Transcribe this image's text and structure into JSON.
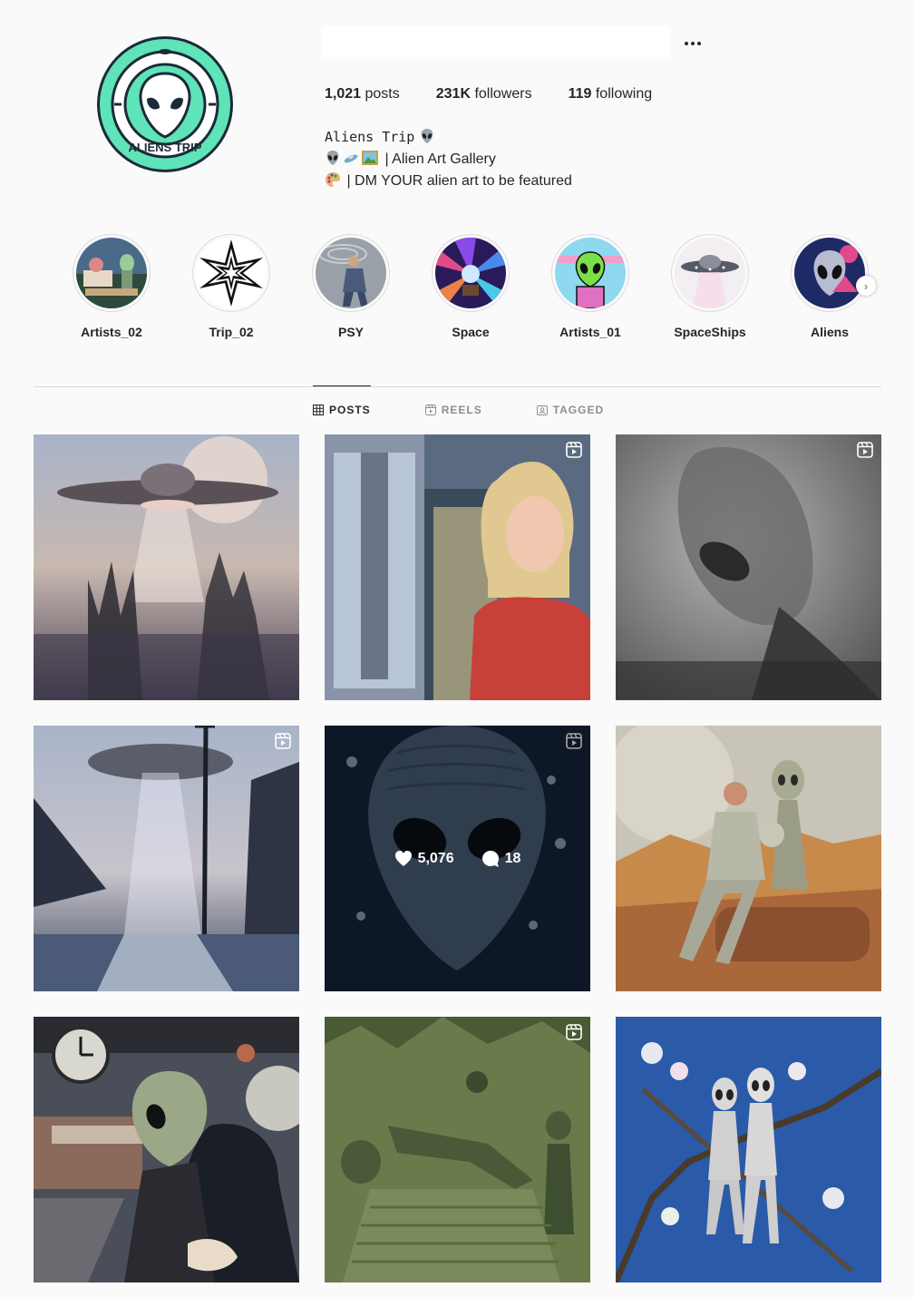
{
  "profile": {
    "username": "",
    "avatar_text": "ALIENS TRIP",
    "stats": [
      {
        "value": "1,021",
        "label": "posts"
      },
      {
        "value": "231K",
        "label": "followers"
      },
      {
        "value": "119",
        "label": "following"
      }
    ],
    "bio": {
      "name": "Aliens Trip",
      "line1": "| Alien Art Gallery",
      "line2": "| DM YOUR alien art to be featured"
    }
  },
  "highlights": [
    {
      "label": "Artists_02",
      "icon": "alien-painting"
    },
    {
      "label": "Trip_02",
      "icon": "op-art-star"
    },
    {
      "label": "PSY",
      "icon": "person-portal"
    },
    {
      "label": "Space",
      "icon": "cosmic-burst"
    },
    {
      "label": "Artists_01",
      "icon": "green-alien-cartoon"
    },
    {
      "label": "SpaceShips",
      "icon": "ufo"
    },
    {
      "label": "Aliens",
      "icon": "alien-face"
    }
  ],
  "tabs": [
    {
      "label": "POSTS",
      "icon": "grid-icon",
      "active": true
    },
    {
      "label": "REELS",
      "icon": "reels-icon",
      "active": false
    },
    {
      "label": "TAGGED",
      "icon": "tag-icon",
      "active": false
    }
  ],
  "posts": [
    {
      "type": "image",
      "subject": "ufo-over-foggy-forest"
    },
    {
      "type": "reel",
      "subject": "news-anchor"
    },
    {
      "type": "reel",
      "subject": "grey-alien-silhouette"
    },
    {
      "type": "reel",
      "subject": "ufo-abduction-street"
    },
    {
      "type": "reel",
      "subject": "alien-close-up",
      "hover": {
        "likes": "5,076",
        "comments": "18"
      }
    },
    {
      "type": "image",
      "subject": "astronaut-and-alien-on-rock"
    },
    {
      "type": "image",
      "subject": "alien-hug-train-station"
    },
    {
      "type": "reel",
      "subject": "aliens-green-scene"
    },
    {
      "type": "image",
      "subject": "alien-figures-in-tree"
    }
  ],
  "colors": {
    "accent_mint": "#5fe3b8",
    "text": "#262626",
    "muted": "#8e8e8e",
    "divider": "#dbdbdb"
  }
}
